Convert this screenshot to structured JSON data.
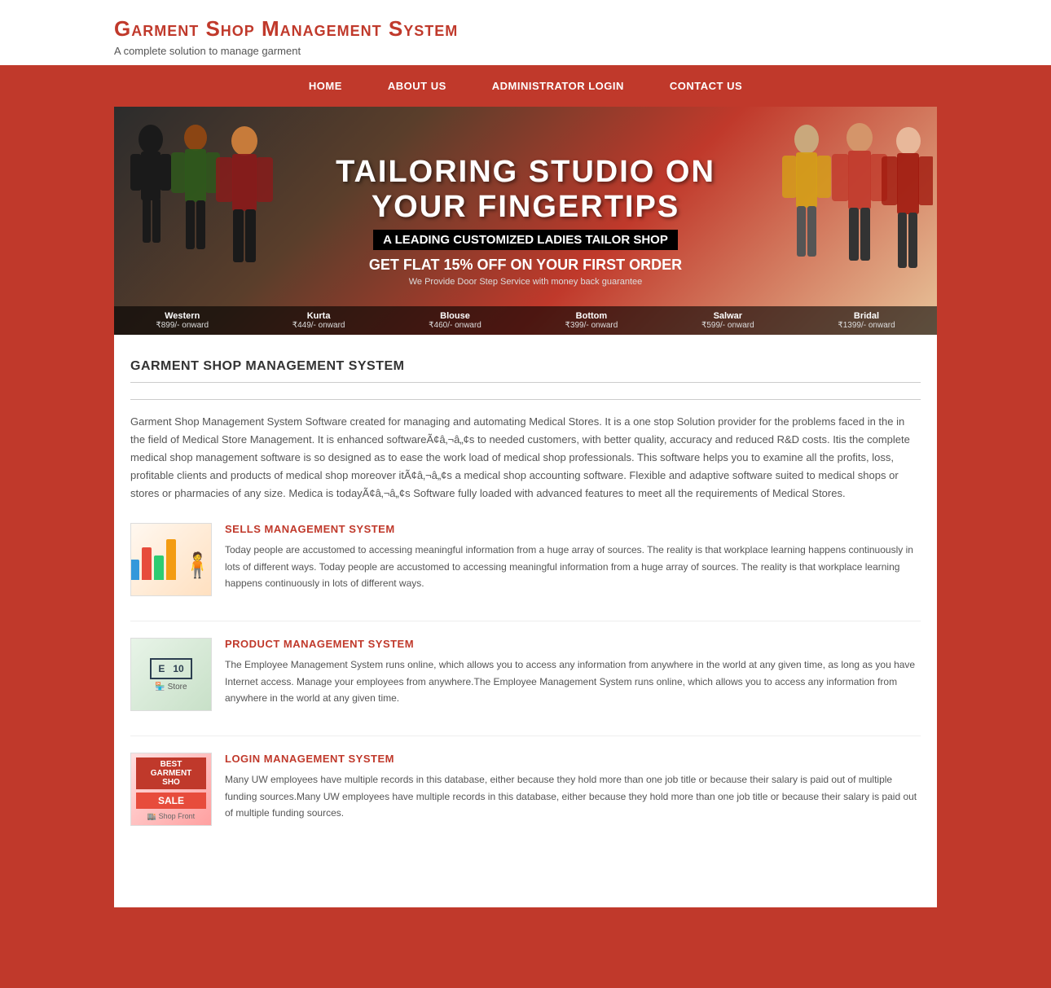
{
  "header": {
    "title": "Garment Shop Management System",
    "subtitle": "A complete solution to manage garment"
  },
  "nav": {
    "items": [
      {
        "label": "HOME",
        "href": "#"
      },
      {
        "label": "ABOUT US",
        "href": "#"
      },
      {
        "label": "ADMINISTRATOR LOGIN",
        "href": "#"
      },
      {
        "label": "CONTACT US",
        "href": "#"
      }
    ]
  },
  "banner": {
    "title": "TAILORING STUDIO ON",
    "title2": "YOUR FINGERTIPS",
    "subtitle": "A LEADING CUSTOMIZED LADIES TAILOR SHOP",
    "offer": "GET FLAT 15% OFF ON YOUR FIRST ORDER",
    "note": "We Provide Door Step Service with money back guarantee",
    "categories": [
      {
        "name": "Western",
        "price": "₹899/- onward"
      },
      {
        "name": "Kurta",
        "price": "₹449/- onward"
      },
      {
        "name": "Blouse",
        "price": "₹460/- onward"
      },
      {
        "name": "Bottom",
        "price": "₹399/- onward"
      },
      {
        "name": "Salwar",
        "price": "₹599/- onward"
      },
      {
        "name": "Bridal",
        "price": "₹1399/- onward"
      }
    ]
  },
  "body": {
    "section_title": "GARMENT SHOP MANAGEMENT SYSTEM",
    "intro_text": "Garment Shop Management System Software created for managing and automating Medical Stores. It is a one stop Solution provider for the problems faced in the in the field of Medical Store Management. It is enhanced softwareÃ¢â‚¬â„¢s to needed customers, with better quality, accuracy and reduced R&D costs. Itis the complete medical shop management software is so designed as to ease the work load of medical shop professionals. This software helps you to examine all the profits, loss, profitable clients and products of medical shop moreover itÃ¢â‚¬â„¢s a medical shop accounting software. Flexible and adaptive software suited to medical shops or stores or pharmacies of any size. Medica is todayÃ¢â‚¬â„¢s Software fully loaded with advanced features to meet all the requirements of Medical Stores.",
    "features": [
      {
        "id": "sells",
        "title": "SELLS MANAGEMENT SYSTEM",
        "text": "Today people are accustomed to accessing meaningful information from a huge array of sources. The reality is that workplace learning happens continuously in lots of different ways. Today people are accustomed to accessing meaningful information from a huge array of sources. The reality is that workplace learning happens continuously in lots of different ways.",
        "img_type": "sells"
      },
      {
        "id": "product",
        "title": "PRODUCT MANAGEMENT SYSTEM",
        "text": "The Employee Management System runs online, which allows you to access any information from anywhere in the world at any given time, as long as you have Internet access. Manage your employees from anywhere.The Employee Management System runs online, which allows you to access any information from anywhere in the world at any given time.",
        "img_type": "product"
      },
      {
        "id": "login",
        "title": "LOGIN MANAGEMENT SYSTEM",
        "text": "Many UW employees have multiple records in this database, either because they hold more than one job title or because their salary is paid out of multiple funding sources.Many UW employees have multiple records in this database, either because they hold more than one job title or because their salary is paid out of multiple funding sources.",
        "img_type": "login"
      }
    ]
  }
}
